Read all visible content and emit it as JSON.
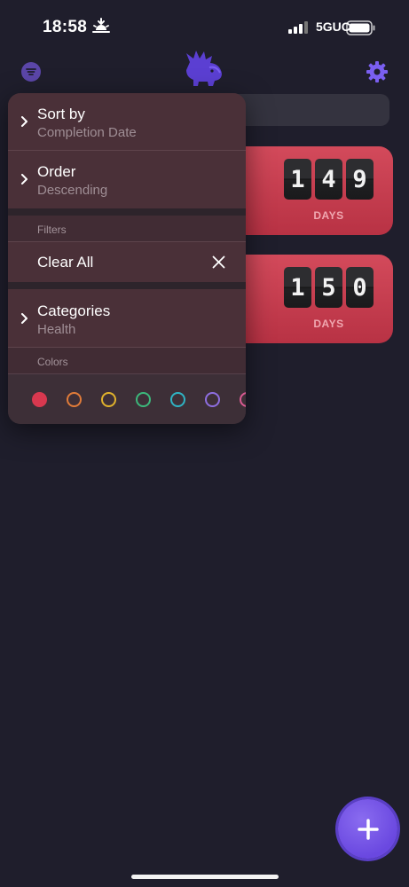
{
  "status_bar": {
    "time": "18:58",
    "network": "5GUC"
  },
  "menu": {
    "sort": {
      "title": "Sort by",
      "value": "Completion Date"
    },
    "order": {
      "title": "Order",
      "value": "Descending"
    },
    "filters_label": "Filters",
    "clear_all": "Clear All",
    "categories": {
      "title": "Categories",
      "value": "Health"
    },
    "colors_label": "Colors",
    "color_options": [
      {
        "color": "#d8384f",
        "selected": true
      },
      {
        "color": "#e07b39",
        "selected": false
      },
      {
        "color": "#e0b22c",
        "selected": false
      },
      {
        "color": "#3cb87b",
        "selected": false
      },
      {
        "color": "#2fb3c3",
        "selected": false
      },
      {
        "color": "#8e6ee0",
        "selected": false
      },
      {
        "color": "#d95a92",
        "selected": false
      }
    ]
  },
  "cards": [
    {
      "digits": [
        "1",
        "4",
        "9"
      ],
      "unit": "DAYS"
    },
    {
      "digits": [
        "1",
        "5",
        "0"
      ],
      "unit": "DAYS"
    }
  ],
  "colors": {
    "background": "#1f1e2c",
    "accent": "#6a48e0",
    "card": "#c93a4d"
  },
  "icons": {
    "filter": "filter-icon",
    "logo": "triceratops-logo",
    "settings": "gear-icon",
    "add": "plus-icon"
  }
}
